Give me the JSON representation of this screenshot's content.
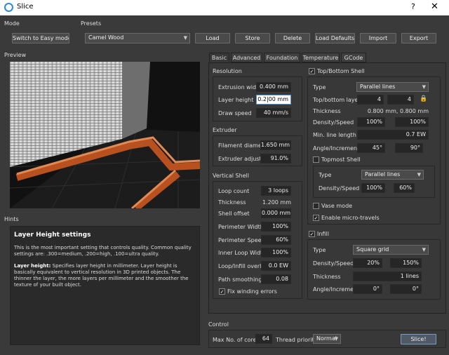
{
  "window": {
    "title": "Slice",
    "help": "?",
    "close": "✕"
  },
  "mode": {
    "label": "Mode",
    "button": "Switch to Easy mode"
  },
  "presets": {
    "label": "Presets",
    "selected": "Camel Wood",
    "buttons": [
      "Load",
      "Store",
      "Delete",
      "Load Defaults",
      "Import",
      "Export"
    ]
  },
  "preview": {
    "label": "Preview"
  },
  "hints": {
    "label": "Hints",
    "heading": "Layer Height settings",
    "p1": "This is the most important setting that controls quality. Common quality settings are: .300=medium, .200=high, .100=ultra quality.",
    "p2_bold": "Layer height:",
    "p2": " Specifies layer height in millimeter. Layer height is basically equivalent to vertical resolution in 3D printed objects. The thinner the layer, the more layers per millimeter and the smoother the texture of your built object."
  },
  "tabs": [
    "Basic",
    "Advanced",
    "Foundation",
    "Temperature",
    "GCode"
  ],
  "resolution": {
    "title": "Resolution",
    "extrusion_width_label": "Extrusion width",
    "extrusion_width": "0.400 mm",
    "layer_height_label": "Layer height",
    "layer_height": "0.2|00 mm",
    "draw_speed_label": "Draw speed",
    "draw_speed": "40 mm/s"
  },
  "extruder": {
    "title": "Extruder",
    "filament_label": "Filament diameter",
    "filament": "1.650 mm",
    "adjust_label": "Extruder adjust",
    "adjust": "91.0%"
  },
  "vertical": {
    "title": "Vertical Shell",
    "loop_count_label": "Loop count",
    "loop_count": "3 loops",
    "thickness_label": "Thickness",
    "thickness": "1.200 mm",
    "offset_label": "Shell offset",
    "offset": "0.000 mm",
    "perim_width_label": "Perimeter Width",
    "perim_width": "100%",
    "perim_speed_label": "Perimeter Speed",
    "perim_speed": "60%",
    "inner_width_label": "Inner Loop Width",
    "inner_width": "100%",
    "overlap_label": "Loop/Infill overlap",
    "overlap": "0.0 EW",
    "smoothing_label": "Path smoothing",
    "smoothing": "0.08",
    "fix_label": "Fix winding errors"
  },
  "topbottom": {
    "title": "Top/Bottom Shell",
    "type_label": "Type",
    "type": "Parallel lines",
    "layers_label": "Top/bottom layers",
    "layers_top": "4",
    "layers_bottom": "4",
    "thickness_label": "Thickness",
    "thickness": "0.800 mm, 0.800 mm",
    "density_label": "Density/Speed",
    "density": "100%",
    "speed": "100%",
    "minline_label": "Min. line length",
    "minline": "0.7 EW",
    "angle_label": "Angle/Increment",
    "angle": "45°",
    "increment": "90°",
    "topmost_label": "Topmost Shell",
    "topmost_type_label": "Type",
    "topmost_type": "Parallel lines",
    "topmost_density_label": "Density/Speed",
    "topmost_density": "100%",
    "topmost_speed": "60%",
    "vase_label": "Vase mode",
    "micro_label": "Enable micro-travels"
  },
  "infill": {
    "title": "Infill",
    "type_label": "Type",
    "type": "Square grid",
    "density_label": "Density/Speed",
    "density": "20%",
    "speed": "150%",
    "thickness_label": "Thickness",
    "thickness": "1 lines",
    "angle_label": "Angle/Increment",
    "angle": "0°",
    "increment": "0°"
  },
  "control": {
    "label": "Control",
    "cores_label": "Max No. of cores",
    "cores": "64",
    "priority_label": "Thread priority",
    "priority": "Normal",
    "slice": "Slice!"
  }
}
